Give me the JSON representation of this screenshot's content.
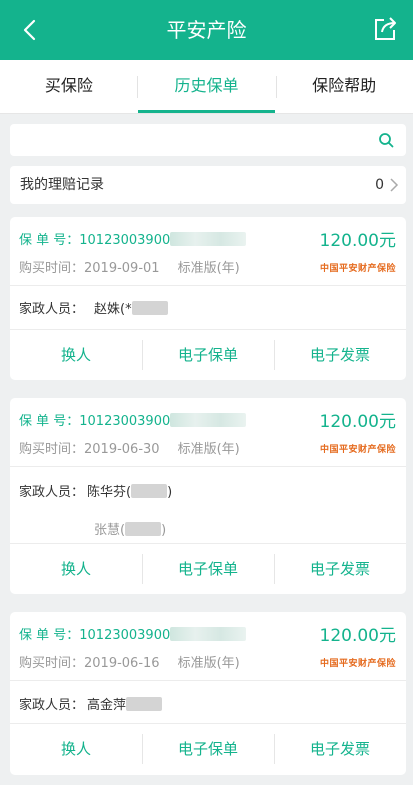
{
  "header": {
    "title": "平安产险",
    "back_icon": "chevron-left-icon",
    "share_icon": "share-icon"
  },
  "tabs": [
    {
      "label": "买保险",
      "active": false
    },
    {
      "label": "历史保单",
      "active": true
    },
    {
      "label": "保险帮助",
      "active": false
    }
  ],
  "search": {
    "placeholder": "",
    "icon": "search-icon"
  },
  "claims": {
    "label": "我的理赔记录",
    "count": "0"
  },
  "labels": {
    "policy_no": "保  单  号：",
    "purchase_time": "购买时间：",
    "worker": "家政人员：",
    "insurer_logo": "中国平安财产保险"
  },
  "actions": {
    "swap": "换人",
    "e_policy": "电子保单",
    "e_invoice": "电子发票"
  },
  "policies": [
    {
      "policy_no": "10123003900",
      "amount": "120.00元",
      "date": "2019-09-01",
      "edition": "标准版(年)",
      "workers": [
        "赵姝(*"
      ]
    },
    {
      "policy_no": "10123003900",
      "amount": "120.00元",
      "date": "2019-06-30",
      "edition": "标准版(年)",
      "workers": [
        "陈华芬(",
        "张慧("
      ]
    },
    {
      "policy_no": "10123003900",
      "amount": "120.00元",
      "date": "2019-06-16",
      "edition": "标准版(年)",
      "workers": [
        "高金萍"
      ]
    }
  ],
  "colors": {
    "brand": "#14b38d",
    "logo": "#e56b1f",
    "background": "#eef0f1"
  }
}
